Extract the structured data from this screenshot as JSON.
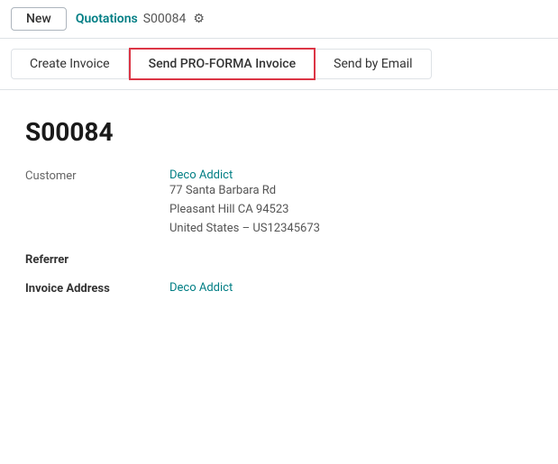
{
  "topbar": {
    "new_label": "New",
    "breadcrumb_title": "Quotations",
    "breadcrumb_sub": "S00084",
    "gear_symbol": "⚙"
  },
  "actions": {
    "create_invoice": "Create Invoice",
    "send_proforma": "Send PRO-FORMA Invoice",
    "send_email": "Send by Email"
  },
  "document": {
    "id": "S00084",
    "fields": [
      {
        "label": "Customer",
        "value_name": "Deco Addict",
        "address": [
          "77 Santa Barbara Rd",
          "Pleasant Hill CA 94523",
          "United States – US12345673"
        ],
        "is_link": true
      },
      {
        "label": "Referrer",
        "value_name": "",
        "is_bold": true
      },
      {
        "label": "Invoice Address",
        "value_name": "Deco Addict",
        "is_link": true
      }
    ]
  }
}
